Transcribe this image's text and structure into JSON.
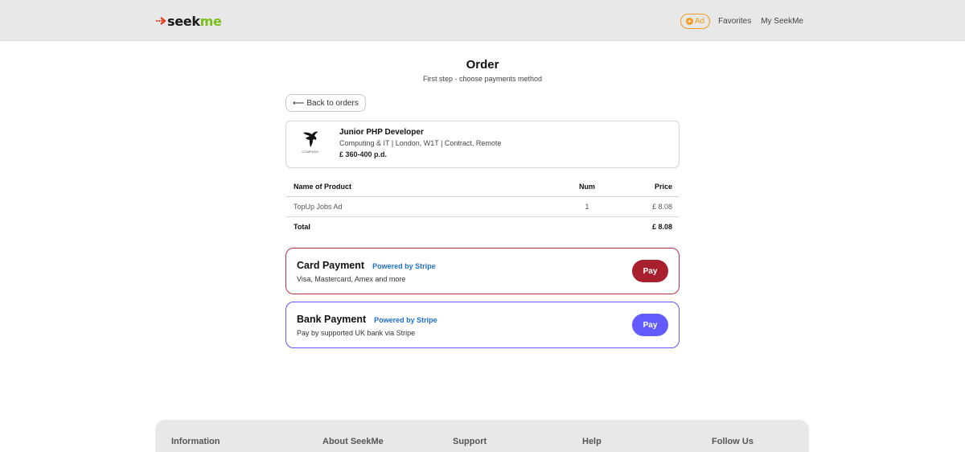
{
  "header": {
    "logo": {
      "seek": "seek",
      "me": "me"
    },
    "nav": {
      "ad_label": "Ad",
      "favorites": "Favorites",
      "my_seekme": "My SeekMe"
    }
  },
  "page": {
    "title": "Order",
    "subtitle": "First step - choose payments method",
    "back_label": "Back to orders"
  },
  "job": {
    "logo_text": "COMPANY",
    "title": "Junior PHP Developer",
    "meta": "Computing & IT | London, W1T | Contract, Remote",
    "salary": "£ 360-400 p.d."
  },
  "order_table": {
    "headers": {
      "name": "Name of Product",
      "num": "Num",
      "price": "Price"
    },
    "rows": [
      {
        "name": "TopUp Jobs Ad",
        "num": "1",
        "price": "£ 8.08"
      }
    ],
    "total": {
      "label": "Total",
      "price": "£ 8.08"
    }
  },
  "payments": [
    {
      "title": "Card Payment",
      "powered": "Powered by Stripe",
      "desc": "Visa, Mastercard, Amex and more",
      "button": "Pay"
    },
    {
      "title": "Bank Payment",
      "powered": "Powered by Stripe",
      "desc": "Pay by supported UK bank via Stripe",
      "button": "Pay"
    }
  ],
  "footer": {
    "columns": [
      "Information",
      "About SeekMe",
      "Support",
      "Help",
      "Follow Us"
    ]
  },
  "colors": {
    "accent_orange": "#f29a1f",
    "logo_green": "#7bbf1e",
    "card_red": "#a8202d",
    "stripe_purple": "#635bff",
    "powered_blue": "#1d6fd6"
  }
}
